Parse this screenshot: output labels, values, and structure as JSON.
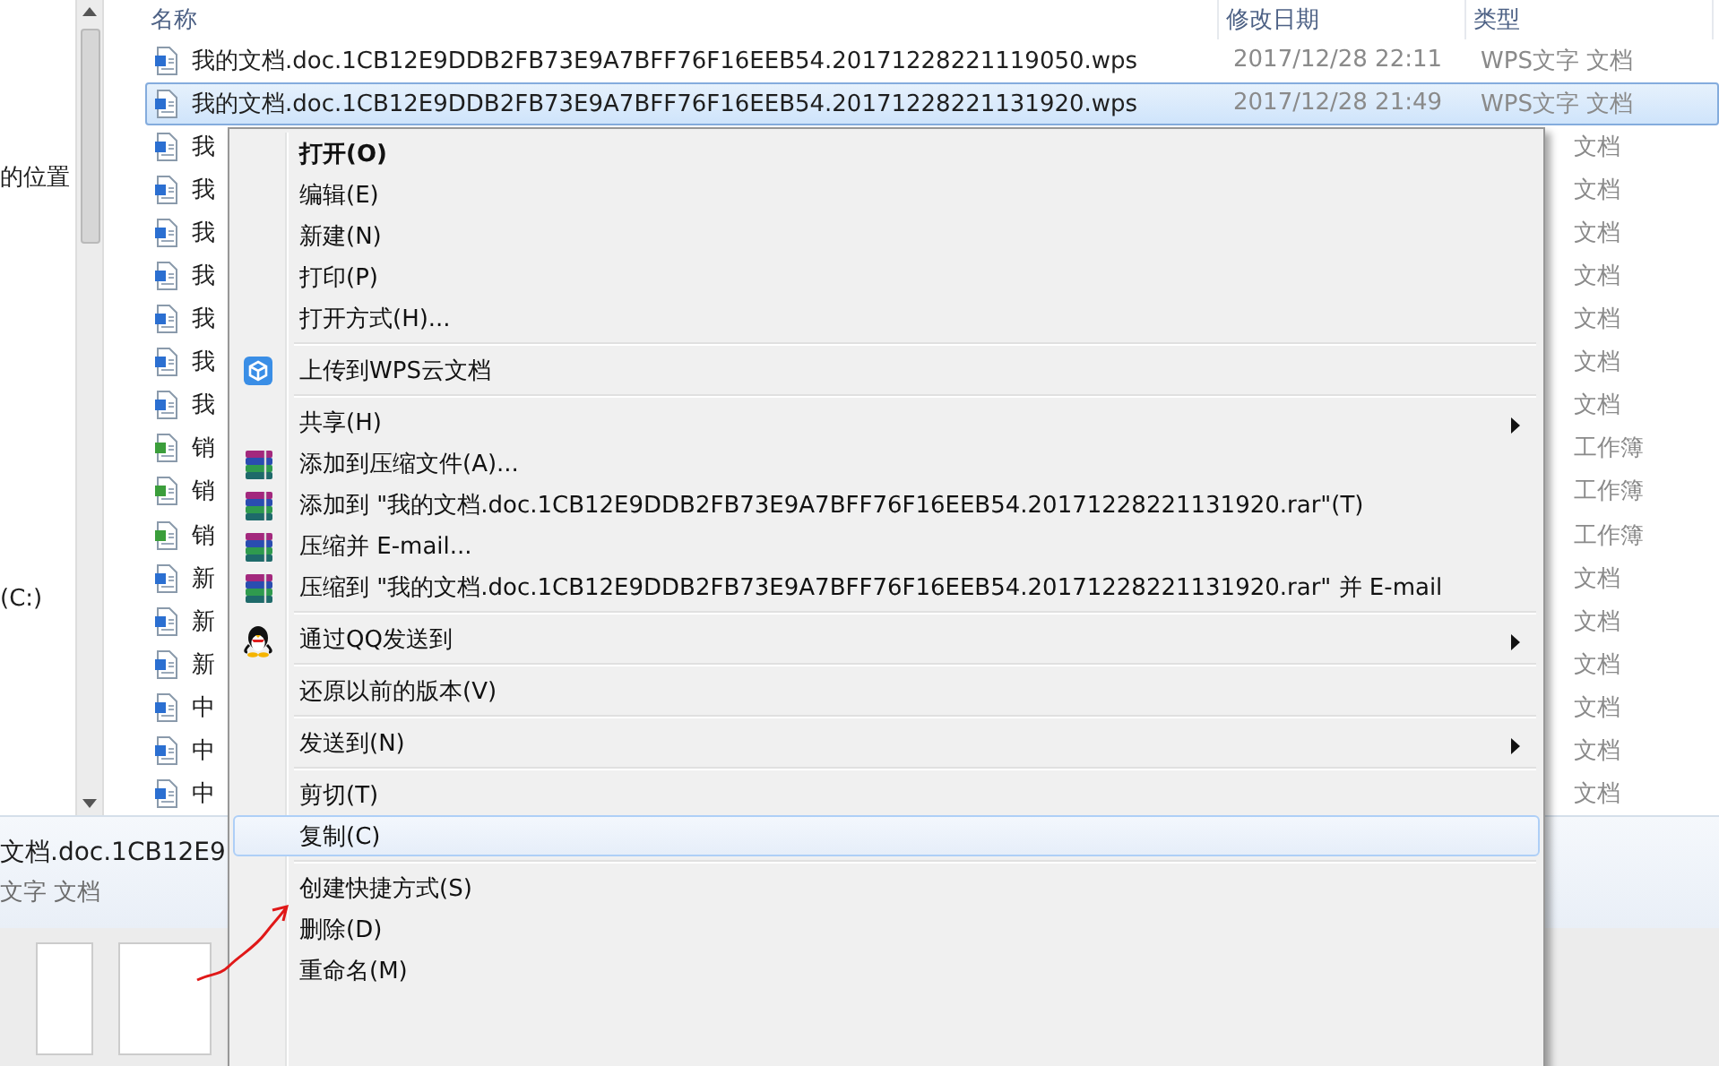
{
  "nav_items": [
    {
      "label": "的位置"
    },
    {
      "label": "(C:)"
    }
  ],
  "columns": [
    {
      "label": "名称"
    },
    {
      "label": "修改日期"
    },
    {
      "label": "类型"
    }
  ],
  "rows": [
    {
      "kind": "doc",
      "name": "我的文档.doc.1CB12E9DDB2FB73E9A7BFF76F16EEB54.20171228221119050.wps",
      "date": "2017/12/28 22:11",
      "type": "WPS文字 文档",
      "selected": false
    },
    {
      "kind": "doc",
      "name": "我的文档.doc.1CB12E9DDB2FB73E9A7BFF76F16EEB54.20171228221131920.wps",
      "date": "2017/12/28 21:49",
      "type": "WPS文字 文档",
      "selected": true
    },
    {
      "kind": "doc",
      "name": "我",
      "type": "文档",
      "selected": false
    },
    {
      "kind": "doc",
      "name": "我",
      "type": "文档",
      "selected": false
    },
    {
      "kind": "doc",
      "name": "我",
      "type": "文档",
      "selected": false
    },
    {
      "kind": "doc",
      "name": "我",
      "type": "文档",
      "selected": false
    },
    {
      "kind": "doc",
      "name": "我",
      "type": "文档",
      "selected": false
    },
    {
      "kind": "doc",
      "name": "我",
      "type": "文档",
      "selected": false
    },
    {
      "kind": "doc",
      "name": "我",
      "type": "文档",
      "selected": false
    },
    {
      "kind": "sheet",
      "name": "销",
      "type": "工作簿",
      "selected": false
    },
    {
      "kind": "sheet",
      "name": "销",
      "type": "工作簿",
      "selected": false
    },
    {
      "kind": "sheet",
      "name": "销",
      "type": "工作簿",
      "selected": false
    },
    {
      "kind": "doc",
      "name": "新",
      "type": "文档",
      "selected": false
    },
    {
      "kind": "doc",
      "name": "新",
      "type": "文档",
      "selected": false
    },
    {
      "kind": "doc",
      "name": "新",
      "type": "文档",
      "selected": false
    },
    {
      "kind": "doc",
      "name": "中",
      "type": "文档",
      "selected": false
    },
    {
      "kind": "doc",
      "name": "中",
      "type": "文档",
      "selected": false
    },
    {
      "kind": "doc",
      "name": "中",
      "type": "文档",
      "selected": false
    }
  ],
  "details": {
    "name": "文档.doc.1CB12E9",
    "type": "文字 文档"
  },
  "context_menu": {
    "groups": [
      [
        {
          "kind": "plain",
          "label": "打开(O)",
          "default": true,
          "submenu": false,
          "selected": false
        },
        {
          "kind": "plain",
          "label": "编辑(E)",
          "default": false,
          "submenu": false,
          "selected": false
        },
        {
          "kind": "plain",
          "label": "新建(N)",
          "default": false,
          "submenu": false,
          "selected": false
        },
        {
          "kind": "plain",
          "label": "打印(P)",
          "default": false,
          "submenu": false,
          "selected": false
        },
        {
          "kind": "plain",
          "label": "打开方式(H)...",
          "default": false,
          "submenu": false,
          "selected": false
        }
      ],
      [
        {
          "kind": "cloud",
          "label": "上传到WPS云文档",
          "default": false,
          "submenu": false,
          "selected": false
        }
      ],
      [
        {
          "kind": "plain",
          "label": "共享(H)",
          "default": false,
          "submenu": true,
          "selected": false
        },
        {
          "kind": "archive",
          "label": "添加到压缩文件(A)...",
          "default": false,
          "submenu": false,
          "selected": false
        },
        {
          "kind": "archive",
          "label": "添加到 \"我的文档.doc.1CB12E9DDB2FB73E9A7BFF76F16EEB54.20171228221131920.rar\"(T)",
          "default": false,
          "submenu": false,
          "selected": false
        },
        {
          "kind": "archive",
          "label": "压缩并 E-mail...",
          "default": false,
          "submenu": false,
          "selected": false
        },
        {
          "kind": "archive",
          "label": "压缩到 \"我的文档.doc.1CB12E9DDB2FB73E9A7BFF76F16EEB54.20171228221131920.rar\" 并 E-mail",
          "default": false,
          "submenu": false,
          "selected": false
        }
      ],
      [
        {
          "kind": "qq",
          "label": "通过QQ发送到",
          "default": false,
          "submenu": true,
          "selected": false
        }
      ],
      [
        {
          "kind": "plain",
          "label": "还原以前的版本(V)",
          "default": false,
          "submenu": false,
          "selected": false
        }
      ],
      [
        {
          "kind": "plain",
          "label": "发送到(N)",
          "default": false,
          "submenu": true,
          "selected": false
        }
      ],
      [
        {
          "kind": "plain",
          "label": "剪切(T)",
          "default": false,
          "submenu": false,
          "selected": false
        },
        {
          "kind": "plain",
          "label": "复制(C)",
          "default": false,
          "submenu": false,
          "selected": true
        }
      ],
      [
        {
          "kind": "plain",
          "label": "创建快捷方式(S)",
          "default": false,
          "submenu": false,
          "selected": false
        },
        {
          "kind": "plain",
          "label": "删除(D)",
          "default": false,
          "submenu": false,
          "selected": false
        },
        {
          "kind": "plain",
          "label": "重命名(M)",
          "default": false,
          "submenu": false,
          "selected": false
        }
      ]
    ]
  }
}
